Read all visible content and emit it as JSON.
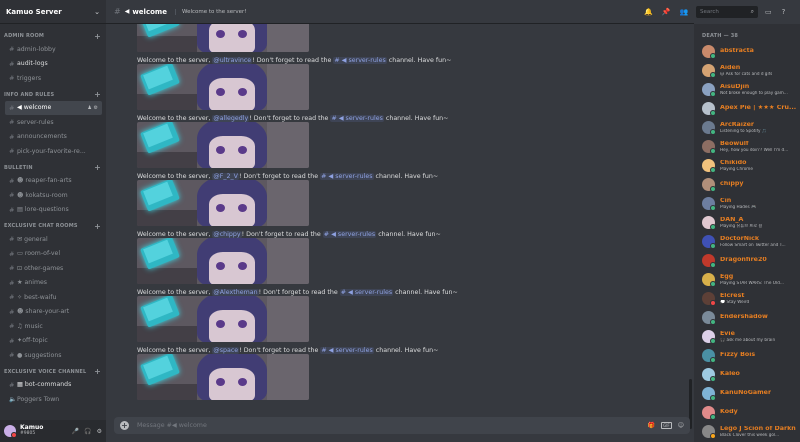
{
  "server": {
    "name": "Kamuo Server"
  },
  "categories": {
    "admin": "ADMIN ROOM",
    "info": "INFO AND RULES",
    "bulletin": "BULLETIN",
    "exclusive_chat": "EXCLUSIVE CHAT ROOMS",
    "exclusive_voice": "EXCLUSIVE VOICE CHANNEL"
  },
  "channels": {
    "admin_lobby": "admin-lobby",
    "audit_logs": "audit-logs",
    "triggers": "triggers",
    "welcome": "welcome",
    "server_rules": "server-rules",
    "announcements": "announcements",
    "pick_role": "pick-your-favorite-re...",
    "reaper_fan_arts": "reaper-fan-arts",
    "kokatsu_room": "kokatsu-room",
    "lore_questions": "lore-questions",
    "general": "general",
    "room_of_vel": "room-of-vel",
    "other_games": "other-games",
    "animes": "animes",
    "best_waifu": "best-waifu",
    "share_your_art": "share-your-art",
    "music": "music",
    "off_topic": "off-topic",
    "suggestions": "suggestions",
    "bot_commands": "bot-commands",
    "poggers_town": "Poggers Town"
  },
  "topbar": {
    "channel": "welcome",
    "topic": "Welcome to the server!"
  },
  "search": {
    "placeholder": "Search"
  },
  "welcome_msg": {
    "prefix": "Welcome to the server, ",
    "middle": "! Don't forget to read the ",
    "channel": "# ◀ server-rules",
    "suffix": " channel. Have fun~"
  },
  "messages": [
    {
      "mention": "@ultravince"
    },
    {
      "mention": "@allegedly"
    },
    {
      "mention": "@F_2_V"
    },
    {
      "mention": "@chippy"
    },
    {
      "mention": "@Alextheman"
    },
    {
      "mention": "@space"
    }
  ],
  "input": {
    "placeholder": "Message #◀ welcome"
  },
  "user": {
    "name": "Kamuo",
    "tag": "#9805"
  },
  "members_category": "DEATH — 38",
  "members": [
    {
      "name": "abstracta",
      "status": "",
      "color": "#e67e22",
      "avatar": "#c98a6b",
      "presence": "online"
    },
    {
      "name": "Aiden",
      "status": "🐱 Ask for cats and d gifs",
      "color": "#e67e22",
      "avatar": "#d4a373",
      "presence": "online"
    },
    {
      "name": "AisuDjin",
      "status": "Not broke enough to play gam...",
      "color": "#e67e22",
      "avatar": "#8aa1c1",
      "presence": "online"
    },
    {
      "name": "Apex Pie | ★★★ Cru...",
      "status": "",
      "color": "#e67e22",
      "avatar": "#b7c1cc",
      "presence": "online"
    },
    {
      "name": "ArcRaizer",
      "status": "Listening to Spotify 🎵",
      "color": "#e67e22",
      "avatar": "#6b7a8f",
      "presence": "online"
    },
    {
      "name": "Beowulf",
      "status": "Hey, how you doin'? Well I'm d...",
      "color": "#e67e22",
      "avatar": "#8d6e63",
      "presence": "online"
    },
    {
      "name": "Chikido",
      "status": "Playing Chrome",
      "color": "#e67e22",
      "avatar": "#f1c27d",
      "presence": "online"
    },
    {
      "name": "chippy",
      "status": "",
      "color": "#e67e22",
      "avatar": "#b08f7a",
      "presence": "online"
    },
    {
      "name": "Cin",
      "status": "Playing Hades 🎮",
      "color": "#e67e22",
      "avatar": "#6d7ea0",
      "presence": "online"
    },
    {
      "name": "DAN_A",
      "status": "Playing 유튜브 프로 용",
      "color": "#e67e22",
      "avatar": "#e0c8d0",
      "presence": "online"
    },
    {
      "name": "DoctorNick",
      "status": "Follow Smart on Twitter and T...",
      "color": "#e67e22",
      "avatar": "#3f51b5",
      "presence": "online"
    },
    {
      "name": "Dragonfire20",
      "status": "",
      "color": "#e67e22",
      "avatar": "#c0392b",
      "presence": "online"
    },
    {
      "name": "Egg",
      "status": "Playing STAR WARS: The Old...",
      "color": "#e67e22",
      "avatar": "#d8b04a",
      "presence": "online"
    },
    {
      "name": "Elcrest",
      "status": "💭 Stay Weird",
      "color": "#e67e22",
      "avatar": "#5d4037",
      "presence": "dnd"
    },
    {
      "name": "Endershadow",
      "status": "",
      "color": "#e67e22",
      "avatar": "#7a8a99",
      "presence": "online"
    },
    {
      "name": "Evie",
      "status": "🎧 ask me about my brain",
      "color": "#e67e22",
      "avatar": "#dcd0e8",
      "presence": "online"
    },
    {
      "name": "Fizzy Bois",
      "status": "",
      "color": "#e67e22",
      "avatar": "#4a90a4",
      "presence": "online"
    },
    {
      "name": "Kaleo",
      "status": "",
      "color": "#e67e22",
      "avatar": "#9ecae1",
      "presence": "online"
    },
    {
      "name": "KanuNoGamer",
      "status": "",
      "color": "#e67e22",
      "avatar": "#7fb3d5",
      "presence": "online"
    },
    {
      "name": "Kody",
      "status": "",
      "color": "#e67e22",
      "avatar": "#e08a8a",
      "presence": "online"
    },
    {
      "name": "Lego J Scion of Darkness",
      "status": "Black Clover this week gol...",
      "color": "#e67e22",
      "avatar": "#888888",
      "presence": "idle"
    }
  ],
  "colors": {
    "bg": "#36393f",
    "sidebar": "#2f3136",
    "mention": "#8ea1e1",
    "member_name": "#e67e22"
  }
}
